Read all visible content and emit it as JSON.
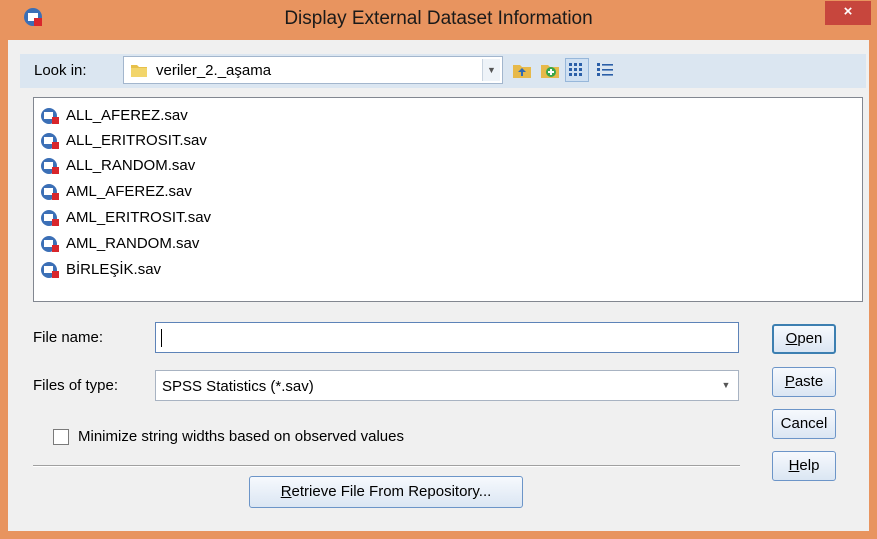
{
  "window": {
    "title": "Display External Dataset Information",
    "close_glyph": "×"
  },
  "lookin": {
    "label": "Look in:",
    "value": "veriler_2._aşama"
  },
  "toolbar": {
    "buttons": [
      "up-folder-icon",
      "new-folder-icon",
      "list-view-icon",
      "details-view-icon"
    ]
  },
  "files": [
    "ALL_AFEREZ.sav",
    "ALL_ERITROSIT.sav",
    "ALL_RANDOM.sav",
    "AML_AFEREZ.sav",
    "AML_ERITROSIT.sav",
    "AML_RANDOM.sav",
    "BİRLEŞİK.sav"
  ],
  "filename": {
    "label": "File name:",
    "value": ""
  },
  "filetype": {
    "label": "Files of type:",
    "value": "SPSS Statistics (*.sav)"
  },
  "checkbox": {
    "label": "Minimize string widths based on observed values",
    "checked": false
  },
  "buttons": {
    "open_first": "O",
    "open_rest": "pen",
    "paste_first": "P",
    "paste_rest": "aste",
    "cancel": "Cancel",
    "help_first": "H",
    "help_rest": "elp",
    "retrieve_first": "R",
    "retrieve_rest": "etrieve File From Repository..."
  },
  "colors": {
    "titlebar": "#e8945f",
    "close": "#c7463d",
    "accent": "#3c7fb1"
  }
}
